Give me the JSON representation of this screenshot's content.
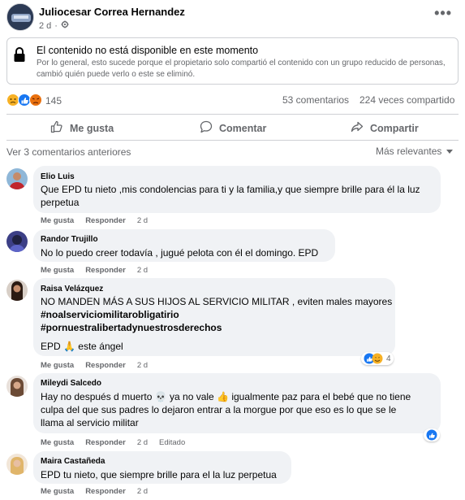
{
  "post": {
    "author": "Juliocesar Correa Hernandez",
    "time": "2 d",
    "dot": "·",
    "more_label": "•••"
  },
  "unavailable": {
    "title": "El contenido no está disponible en este momento",
    "description": "Por lo general, esto sucede porque el propietario solo compartió el contenido con un grupo reducido de personas, cambió quién puede verlo o este se eliminó."
  },
  "stats": {
    "reactions_count": "145",
    "comments": "53 comentarios",
    "shares": "224 veces compartido"
  },
  "actions": {
    "like": "Me gusta",
    "comment": "Comentar",
    "share": "Compartir"
  },
  "comments_section": {
    "previous": "Ver 3 comentarios anteriores",
    "sort": "Más relevantes"
  },
  "comments": [
    {
      "name": "Elio Luis",
      "lines": [
        "Que EPD tu nieto ,mis condolencias para ti y la familia,y que siempre brille para él la luz",
        "perpetua"
      ],
      "like": "Me gusta",
      "reply": "Responder",
      "time": "2 d"
    },
    {
      "name": "Randor Trujillo",
      "lines": [
        "No lo puedo creer todavía , jugué pelota con él el domingo. EPD"
      ],
      "like": "Me gusta",
      "reply": "Responder",
      "time": "2 d"
    },
    {
      "name": "Raisa Velázquez",
      "lines": [
        "NO MANDEN MÁS A SUS HIJOS AL SERVICIO MILITAR , eviten males mayores",
        "#noalserviciomilitarobligatirio",
        "#pornuestralibertadynuestrosderechos",
        "",
        "EPD 🙏 este ángel"
      ],
      "like": "Me gusta",
      "reply": "Responder",
      "time": "2 d",
      "reaction_count": "4"
    },
    {
      "name": "Mileydi Salcedo",
      "lines": [
        "Hay no después d muerto 💀 ya no vale 👍 igualmente paz para el bebé que no tiene",
        "culpa del que sus padres lo dejaron entrar a la morgue por que eso es lo que se le",
        "llama al servicio militar"
      ],
      "like": "Me gusta",
      "reply": "Responder",
      "time": "2 d",
      "edited": "Editado"
    },
    {
      "name": "Maira Castañeda",
      "lines": [
        "EPD tu nieto, que siempre brille para el la luz perpetua"
      ],
      "like": "Me gusta",
      "reply": "Responder",
      "time": "2 d"
    }
  ],
  "colors": {
    "accent": "#1877f2",
    "muted": "#65676b",
    "bubble": "#f0f2f5"
  }
}
